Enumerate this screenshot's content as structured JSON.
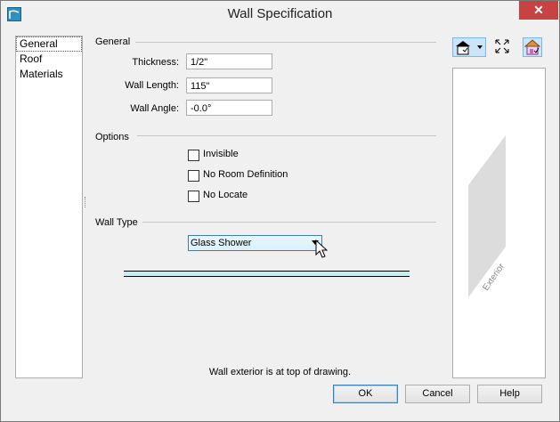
{
  "window": {
    "title": "Wall Specification",
    "close_glyph": "✕"
  },
  "nav": {
    "items": [
      {
        "label": "General"
      },
      {
        "label": "Roof"
      },
      {
        "label": "Materials"
      }
    ]
  },
  "general": {
    "heading": "General",
    "thickness": {
      "label": "Thickness:",
      "value": "1/2\""
    },
    "wall_length": {
      "label": "Wall Length:",
      "value": "115\""
    },
    "wall_angle": {
      "label": "Wall Angle:",
      "value": "-0.0°"
    }
  },
  "options": {
    "heading": "Options",
    "invisible": {
      "label": "Invisible",
      "checked": false
    },
    "no_room_definition": {
      "label": "No Room Definition",
      "checked": false
    },
    "no_locate": {
      "label": "No Locate",
      "checked": false
    }
  },
  "wall_type": {
    "heading": "Wall Type",
    "selected": "Glass Shower"
  },
  "preview": {
    "exterior_label": "Exterior"
  },
  "hint": "Wall exterior is at top of drawing.",
  "buttons": {
    "ok": "OK",
    "cancel": "Cancel",
    "help": "Help"
  },
  "colors": {
    "accent": "#3c7fb1",
    "wall_fill": "#c5efef",
    "close": "#c74242"
  },
  "icons": [
    "app-icon",
    "close-icon",
    "view-dropdown-icon",
    "fit-icon",
    "house-view-icon",
    "pointer-cursor-icon"
  ]
}
